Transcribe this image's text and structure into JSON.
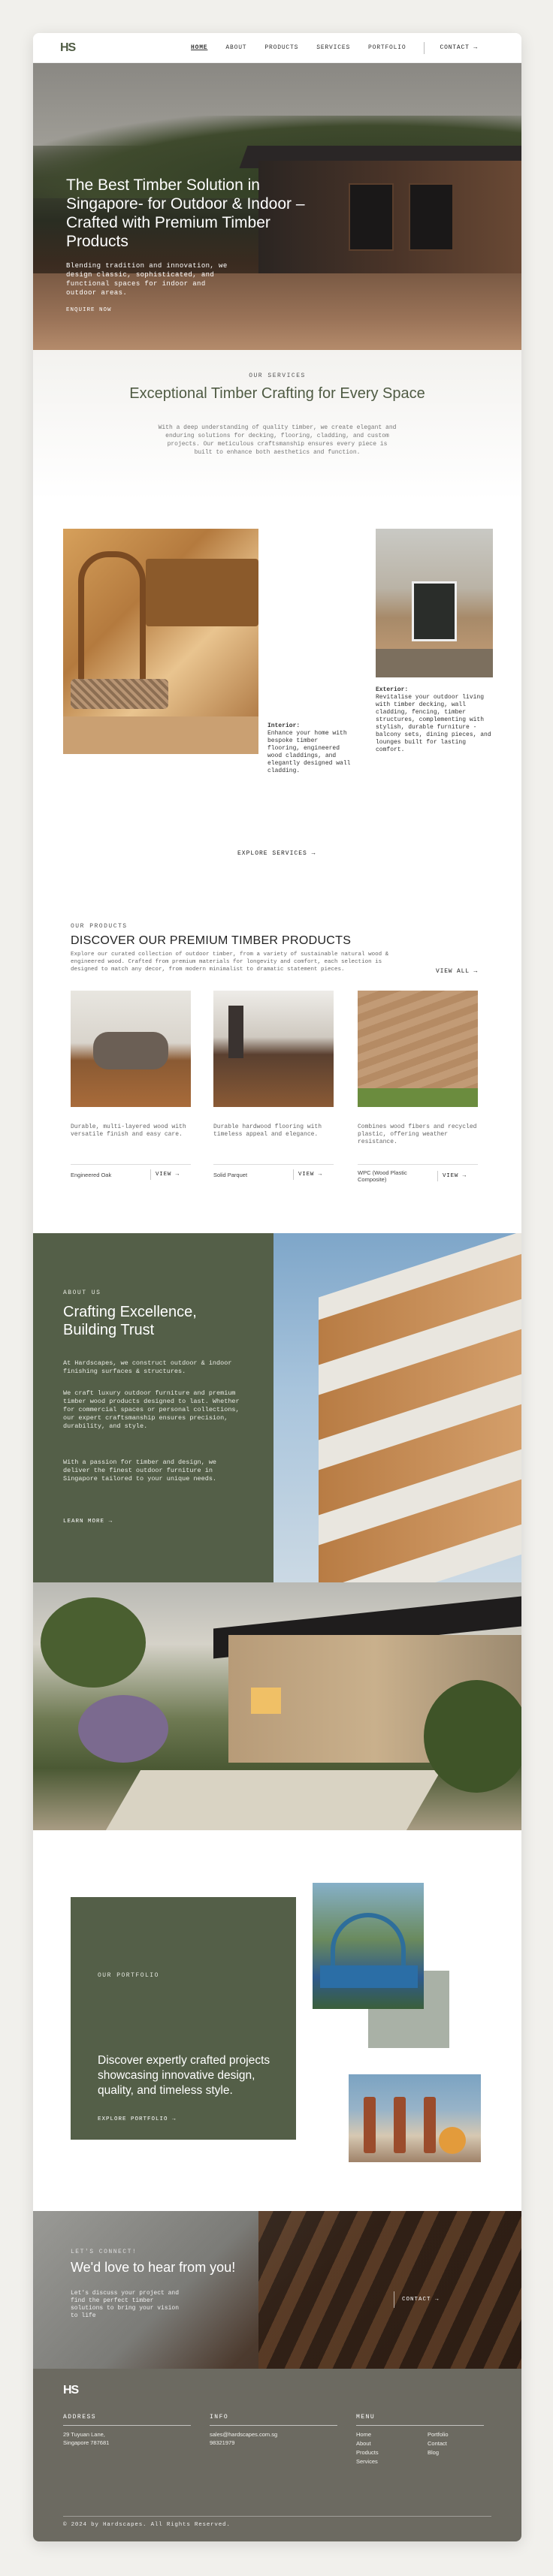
{
  "nav": {
    "logo": "HS",
    "items": [
      {
        "label": "HOME",
        "active": true
      },
      {
        "label": "ABOUT",
        "active": false
      },
      {
        "label": "PRODUCTS",
        "active": false
      },
      {
        "label": "SERVICES",
        "active": false
      },
      {
        "label": "PORTFOLIO",
        "active": false
      }
    ],
    "contact": "CONTACT →"
  },
  "hero": {
    "title": "The Best Timber Solution in Singapore- for Outdoor & Indoor – Crafted with Premium Timber Products",
    "subtitle": "Blending tradition and innovation, we design classic, sophisticated, and functional spaces for indoor and outdoor areas.",
    "button": "ENQUIRE NOW"
  },
  "services": {
    "eyebrow": "OUR SERVICES",
    "title": "Exceptional Timber Crafting for Every Space",
    "description": "With a deep understanding of quality timber, we create elegant and enduring solutions for decking, flooring, cladding, and custom projects. Our meticulous craftsmanship ensures every piece is built to enhance both aesthetics and function.",
    "interior_label": "Interior:",
    "interior_text": "Enhance your home with bespoke timber flooring, engineered wood claddings, and elegantly designed wall cladding.",
    "exterior_label": "Exterior:",
    "exterior_text": "Revitalise your outdoor living with timber decking, wall cladding, fencing, timber structures, complementing with stylish, durable furniture - balcony sets, dining pieces, and lounges built for lasting comfort.",
    "explore": "EXPLORE SERVICES →"
  },
  "products": {
    "eyebrow": "OUR PRODUCTS",
    "title": "DISCOVER OUR PREMIUM TIMBER PRODUCTS",
    "description": "Explore our curated collection of outdoor timber, from a variety of sustainable natural wood & engineered wood. Crafted from premium materials for longevity and comfort, each selection is designed to match any decor, from modern minimalist to dramatic statement pieces.",
    "view_all": "VIEW ALL →",
    "items": [
      {
        "desc": "Durable, multi-layered wood with versatile finish and easy care.",
        "name": "Engineered Oak",
        "view": "VIEW →"
      },
      {
        "desc": "Durable hardwood flooring with timeless appeal and elegance.",
        "name": "Solid Parquet",
        "view": "VIEW →"
      },
      {
        "desc": "Combines wood fibers and recycled plastic, offering weather resistance.",
        "name": "WPC (Wood Plastic Composite)",
        "view": "VIEW →"
      }
    ]
  },
  "about": {
    "eyebrow": "ABOUT US",
    "title": "Crafting Excellence, Building Trust",
    "p1": "At Hardscapes, we construct outdoor & indoor finishing surfaces & structures.",
    "p2": "We craft luxury outdoor furniture and premium timber wood products designed to last. Whether for commercial spaces or personal collections, our expert craftsmanship ensures precision, durability, and style.",
    "p3": "With a passion for timber and design, we deliver the finest outdoor furniture in Singapore tailored to your unique needs.",
    "learn_more": "LEARN MORE →"
  },
  "portfolio": {
    "eyebrow": "OUR PORTFOLIO",
    "title": "Discover expertly crafted projects showcasing innovative design, quality, and timeless style.",
    "link": "EXPLORE PORTFOLIO →"
  },
  "contact": {
    "eyebrow": "LET'S CONNECT!",
    "title": "We'd love to hear from you!",
    "description": "Let's discuss your project and find the perfect timber solutions to bring your vision to life",
    "button": "CONTACT →"
  },
  "footer": {
    "logo": "HS",
    "address_head": "ADDRESS",
    "address_1": "29 Tuyuan Lane,",
    "address_2": "Singapore 787681",
    "info_head": "INFO",
    "email": "sales@hardscapes.com.sg",
    "phone": "98321979",
    "menu_head": "MENU",
    "menu": [
      "Home",
      "Portfolio",
      "About",
      "Contact",
      "Products",
      "Blog",
      "Services"
    ],
    "copyright": "© 2024 by Hardscapes. All Rights Reserved."
  }
}
